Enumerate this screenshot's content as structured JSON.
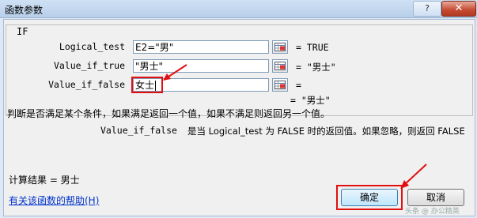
{
  "window": {
    "title": "函数参数",
    "help_button": "?",
    "close_button": "✕"
  },
  "function": {
    "name": "IF",
    "arguments": [
      {
        "label": "Logical_test",
        "value": "E2=\"男\"",
        "result": "= TRUE"
      },
      {
        "label": "Value_if_true",
        "value": "\"男士\"",
        "result": "= \"男士\""
      },
      {
        "label": "Value_if_false",
        "value": "女士",
        "result": "="
      }
    ],
    "result": "= \"男士\"",
    "description": "判断是否满足某个条件，如果满足返回一个值，如果不满足则返回另一个值。",
    "arg_description_name": "Value_if_false",
    "arg_description_text": "是当 Logical_test 为 FALSE 时的返回值。如果忽略，则返回 FALSE"
  },
  "calc_result": "计算结果 = 男士",
  "help_link": "有关该函数的帮助(H)",
  "buttons": {
    "ok": "确定",
    "cancel": "取消"
  },
  "watermark": "头条 @ 办公精英",
  "colors": {
    "highlight_red": "#e01010",
    "link_blue": "#0033cc"
  }
}
